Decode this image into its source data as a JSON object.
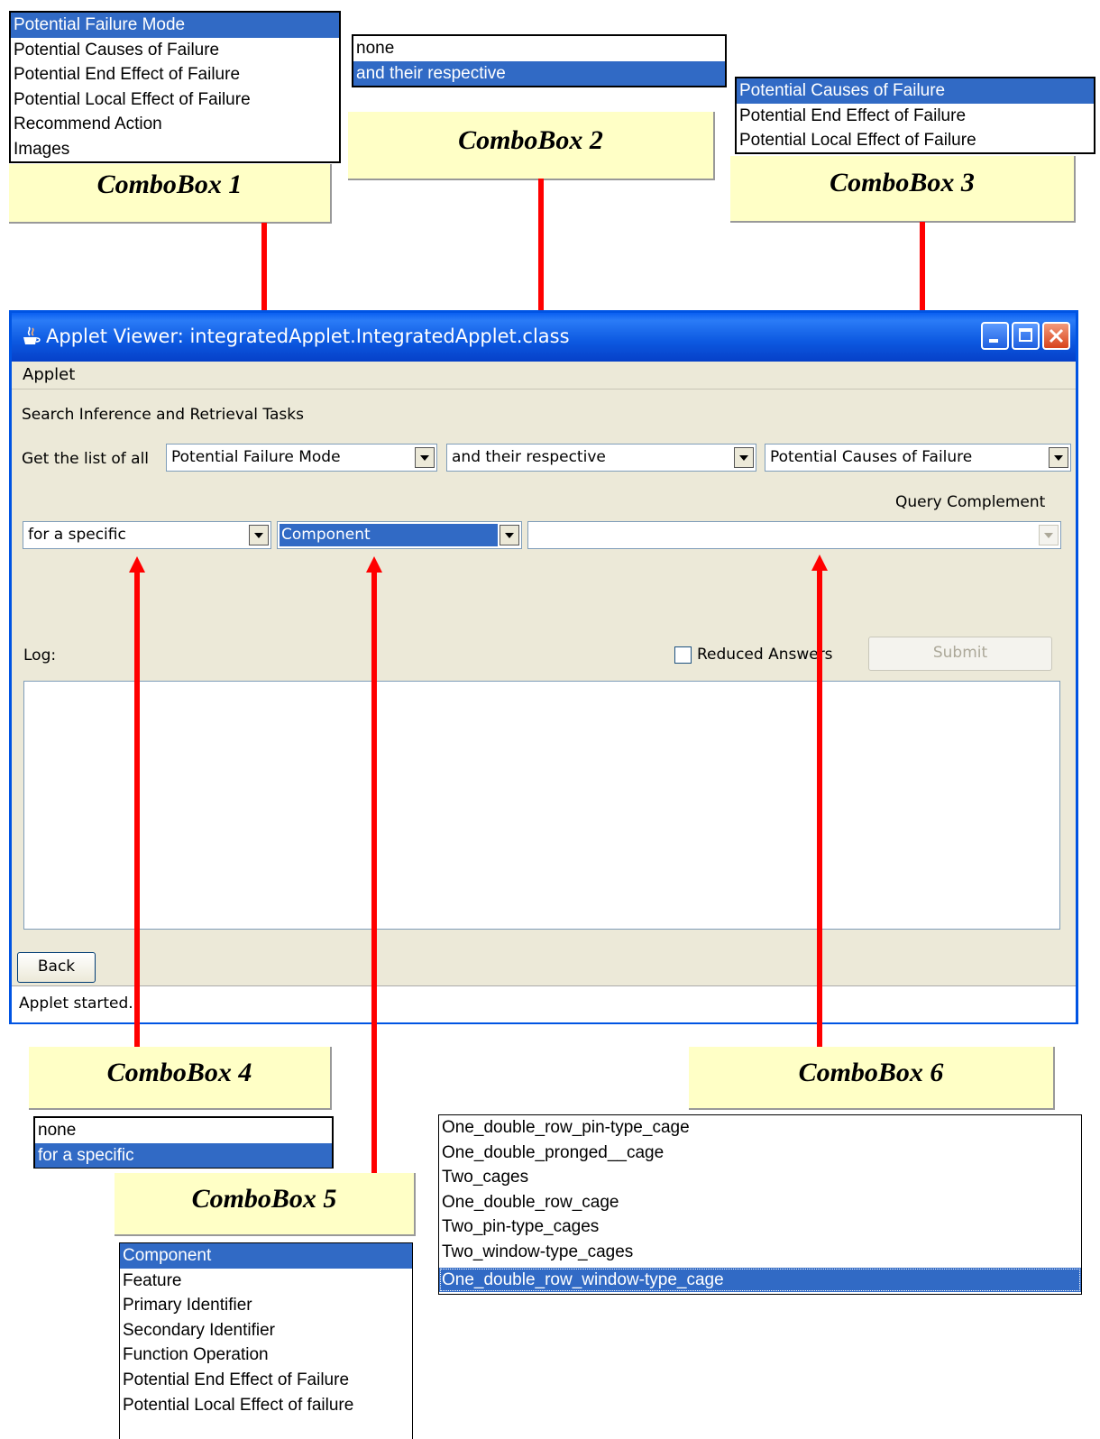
{
  "window": {
    "title": "Applet Viewer: integratedApplet.IntegratedApplet.class",
    "menu": "Applet",
    "status": "Applet started."
  },
  "form": {
    "section_title": "Search Inference and Retrieval Tasks",
    "get_list_label": "Get the list of all",
    "combo1_value": "Potential Failure Mode",
    "combo2_value": "and their respective",
    "combo3_value": "Potential Causes of Failure",
    "query_complement_label": "Query Complement",
    "combo4_value": "for a specific",
    "combo5_value": "Component",
    "combo6_value": "",
    "log_label": "Log:",
    "reduced_answers_label": "Reduced Answers",
    "submit_label": "Submit",
    "back_label": "Back"
  },
  "callouts": {
    "c1": "ComboBox 1",
    "c2": "ComboBox 2",
    "c3": "ComboBox 3",
    "c4": "ComboBox 4",
    "c5": "ComboBox 5",
    "c6": "ComboBox 6"
  },
  "lists": {
    "combo1": [
      "Potential Failure Mode",
      "Potential Causes of Failure",
      "Potential End Effect of Failure",
      "Potential Local Effect of Failure",
      "Recommend Action",
      "Images"
    ],
    "combo2": [
      "none",
      "and their respective"
    ],
    "combo3": [
      "Potential Causes of Failure",
      "Potential End Effect of Failure",
      "Potential Local Effect of Failure"
    ],
    "combo4": [
      "none",
      "for a specific"
    ],
    "combo5": [
      "Component",
      "Feature",
      "Primary Identifier",
      "Secondary Identifier",
      "Function Operation",
      "Potential End Effect of Failure",
      "Potential Local Effect of failure"
    ],
    "combo6": [
      "One_double_row_pin-type_cage",
      "One_double_pronged__cage",
      "Two_cages",
      "One_double_row_cage",
      "Two_pin-type_cages",
      "Two_window-type_cages",
      "One_double_row_window-type_cage"
    ]
  },
  "colors": {
    "selection": "#316ac5",
    "callout_bg": "#ffffc6",
    "arrow": "#ff0000",
    "titlebar": "#0c58e0"
  }
}
